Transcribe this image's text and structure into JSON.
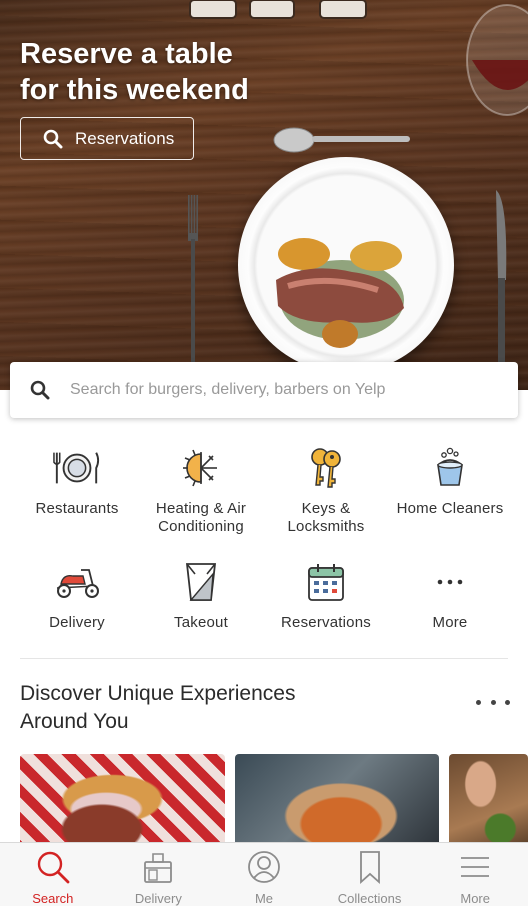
{
  "hero": {
    "title_line1": "Reserve a table",
    "title_line2": "for this weekend",
    "button_label": "Reservations"
  },
  "search": {
    "placeholder": "Search for burgers, delivery, barbers on Yelp"
  },
  "categories": [
    {
      "label_line1": "Restaurants",
      "label_line2": "",
      "icon": "fork-plate-knife-icon"
    },
    {
      "label_line1": "Heating & Air",
      "label_line2": "Conditioning",
      "icon": "sun-snowflake-icon"
    },
    {
      "label_line1": "Keys &",
      "label_line2": "Locksmiths",
      "icon": "keys-icon"
    },
    {
      "label_line1": "Home Cleaners",
      "label_line2": "",
      "icon": "cleaning-bucket-icon"
    },
    {
      "label_line1": "Delivery",
      "label_line2": "",
      "icon": "scooter-icon"
    },
    {
      "label_line1": "Takeout",
      "label_line2": "",
      "icon": "takeout-box-icon"
    },
    {
      "label_line1": "Reservations",
      "label_line2": "",
      "icon": "calendar-icon"
    },
    {
      "label_line1": "More",
      "label_line2": "",
      "icon": "more-dots-icon"
    }
  ],
  "discover": {
    "title_line1": "Discover Unique Experiences",
    "title_line2": "Around You"
  },
  "tabbar": {
    "active": "Search",
    "items": [
      {
        "label": "Search",
        "icon": "search-icon"
      },
      {
        "label": "Delivery",
        "icon": "delivery-bag-icon"
      },
      {
        "label": "Me",
        "icon": "user-circle-icon"
      },
      {
        "label": "Collections",
        "icon": "bookmark-icon"
      },
      {
        "label": "More",
        "icon": "hamburger-menu-icon"
      }
    ]
  },
  "colors": {
    "brand_red": "#d32323",
    "tab_inactive": "#8c8c8c"
  }
}
